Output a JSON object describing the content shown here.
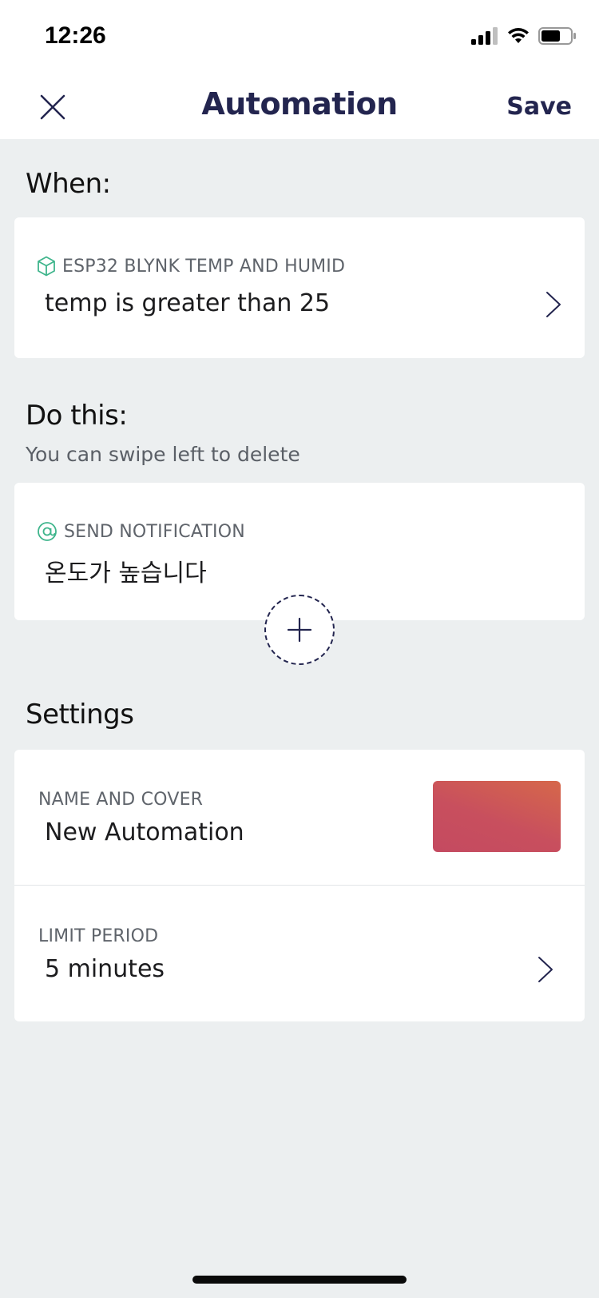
{
  "status_bar": {
    "time": "12:26"
  },
  "nav": {
    "title": "Automation",
    "save_label": "Save",
    "close_icon": "close-icon"
  },
  "when": {
    "heading": "When:",
    "trigger": {
      "icon": "cube-icon",
      "device": "ESP32 BLYNK TEMP AND HUMID",
      "condition": "temp is greater than 25"
    }
  },
  "do_this": {
    "heading": "Do this:",
    "hint": "You can swipe left to delete",
    "action": {
      "icon": "at-icon",
      "type": "SEND NOTIFICATION",
      "message": "온도가 높습니다"
    },
    "add_icon": "plus-icon"
  },
  "settings": {
    "heading": "Settings",
    "name_and_cover": {
      "label": "NAME AND COVER",
      "value": "New Automation"
    },
    "limit_period": {
      "label": "LIMIT PERIOD",
      "value": "5 minutes"
    }
  },
  "colors": {
    "accent": "#23254f",
    "trigger_icon": "#3fb58c",
    "background": "#eceff0",
    "cover_start": "#d6684a",
    "cover_end": "#c44a60"
  }
}
